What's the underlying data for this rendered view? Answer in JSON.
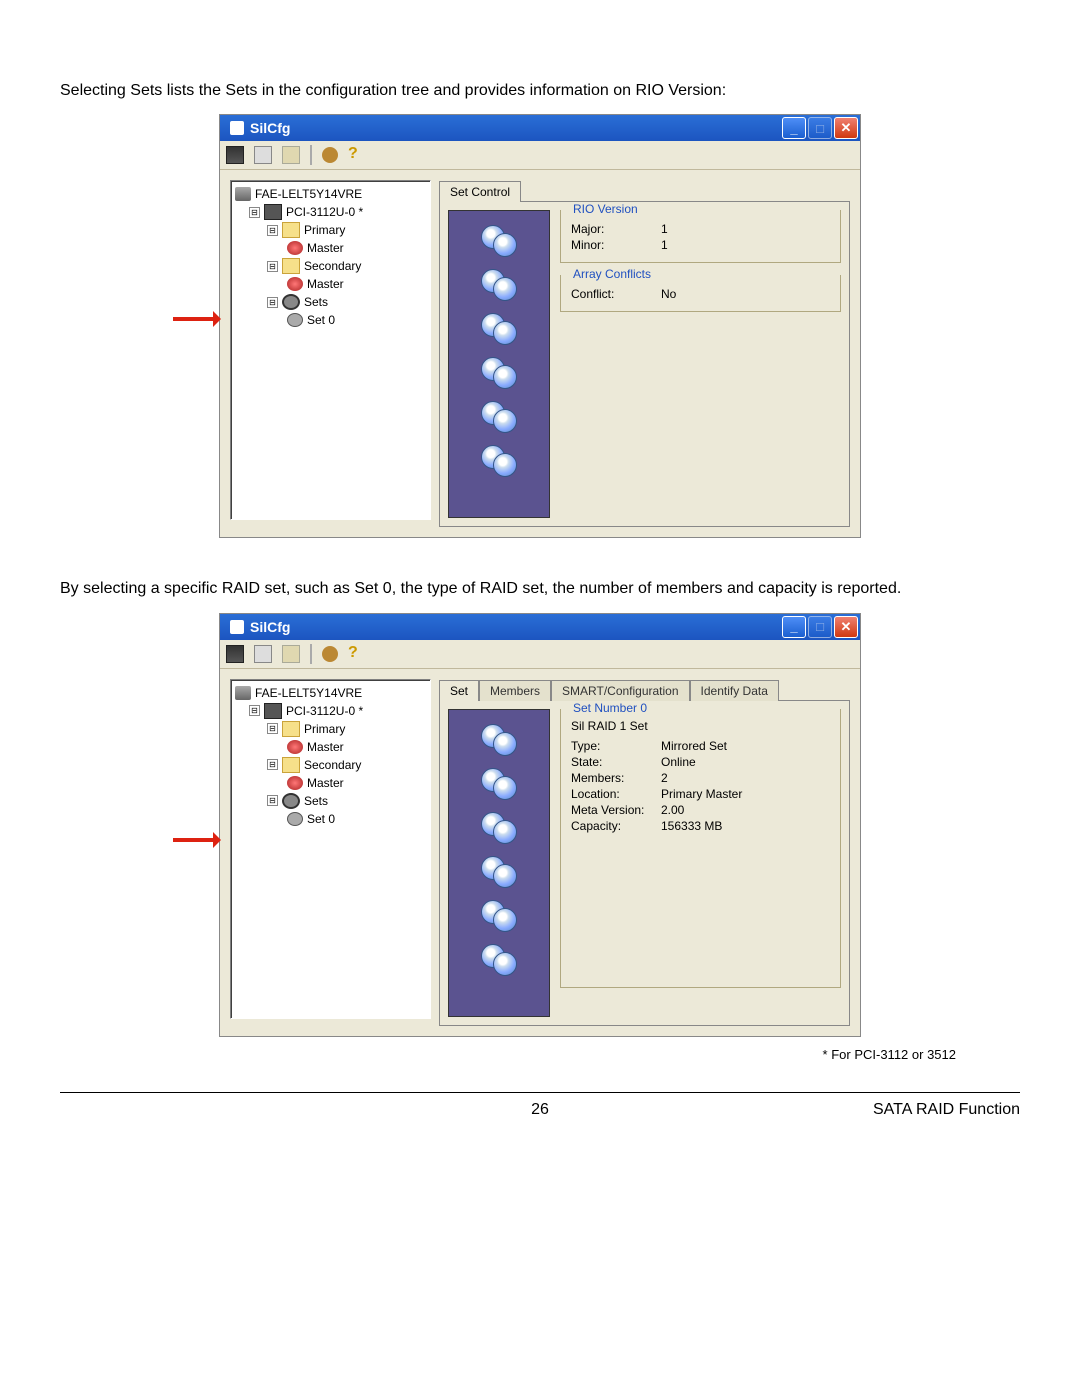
{
  "doc": {
    "para1": "Selecting Sets lists the Sets in the configuration tree and provides information on RIO Version:",
    "para2": "By selecting a specific RAID set, such as Set 0, the type of RAID set, the number of members and capacity is reported.",
    "footnote": "* For PCI-3112 or 3512",
    "pagenum": "26",
    "footer_right": "SATA RAID Function"
  },
  "win": {
    "title": "SilCfg",
    "min": "_",
    "max": "□",
    "close": "✕"
  },
  "toolbar": {
    "help": "?"
  },
  "tree": {
    "root": "FAE-LELT5Y14VRE",
    "card": "PCI-3112U-0 *",
    "primary": "Primary",
    "secondary": "Secondary",
    "master": "Master",
    "sets": "Sets",
    "set0": "Set 0",
    "exp": "⊟"
  },
  "shot1": {
    "tab": "Set Control",
    "grp1_title": "RIO Version",
    "major_k": "Major:",
    "major_v": "1",
    "minor_k": "Minor:",
    "minor_v": "1",
    "grp2_title": "Array Conflicts",
    "conf_k": "Conflict:",
    "conf_v": "No"
  },
  "shot2": {
    "tabs": {
      "set": "Set",
      "members": "Members",
      "smart": "SMART/Configuration",
      "ident": "Identify Data"
    },
    "grp_title": "Set Number 0",
    "setname": "Sil RAID 1 Set",
    "type_k": "Type:",
    "type_v": "Mirrored Set",
    "state_k": "State:",
    "state_v": "Online",
    "mem_k": "Members:",
    "mem_v": "2",
    "loc_k": "Location:",
    "loc_v": "Primary Master",
    "meta_k": "Meta Version:",
    "meta_v": "2.00",
    "cap_k": "Capacity:",
    "cap_v": "156333 MB"
  }
}
